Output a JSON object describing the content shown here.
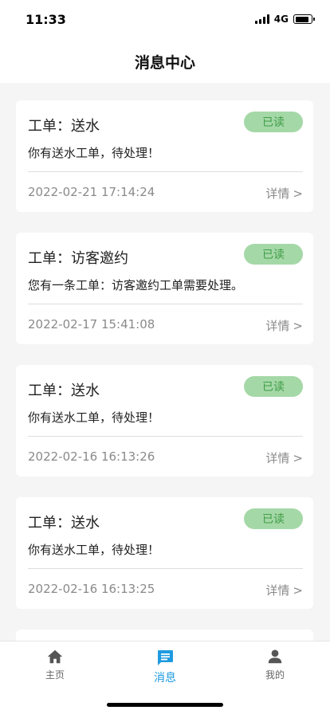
{
  "status_bar": {
    "time": "11:33",
    "network": "4G",
    "signal_bars": 4,
    "battery_level": 0.85
  },
  "header": {
    "title": "消息中心"
  },
  "messages": [
    {
      "title": "工单：送水",
      "status": "已读",
      "description": "你有送水工单，待处理！",
      "time": "2022-02-21 17:14:24",
      "detail_label": "详情",
      "chevron": ">"
    },
    {
      "title": "工单：访客邀约",
      "status": "已读",
      "description": "您有一条工单：访客邀约工单需要处理。",
      "time": "2022-02-17 15:41:08",
      "detail_label": "详情",
      "chevron": ">"
    },
    {
      "title": "工单：送水",
      "status": "已读",
      "description": "你有送水工单，待处理！",
      "time": "2022-02-16 16:13:26",
      "detail_label": "详情",
      "chevron": ">"
    },
    {
      "title": "工单：送水",
      "status": "已读",
      "description": "你有送水工单，待处理！",
      "time": "2022-02-16 16:13:25",
      "detail_label": "详情",
      "chevron": ">"
    }
  ],
  "tab_bar": {
    "items": [
      {
        "label": "主页",
        "icon": "home-icon"
      },
      {
        "label": "消息",
        "icon": "message-icon"
      },
      {
        "label": "我的",
        "icon": "user-icon"
      }
    ],
    "active_index": 1
  },
  "colors": {
    "accent": "#1e9be0",
    "badge_bg": "#a5d8a7",
    "badge_text": "#3f9d47",
    "page_bg": "#f5f5f5"
  }
}
